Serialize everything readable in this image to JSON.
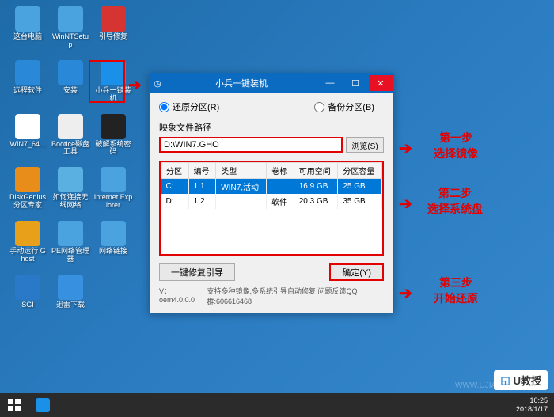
{
  "desktop_icons": [
    {
      "name": "mypc",
      "label": "这台电脑",
      "color": "#4aa3df"
    },
    {
      "name": "winntsetup",
      "label": "WinNTSetup",
      "color": "#4aa3df"
    },
    {
      "name": "bootrepair",
      "label": "引导修复",
      "color": "#d63333"
    },
    {
      "name": "remote",
      "label": "远程软件",
      "color": "#2a88d8"
    },
    {
      "name": "install",
      "label": "安装",
      "color": "#2a88d8"
    },
    {
      "name": "xiaobingk",
      "label": "小兵一键装机",
      "color": "#1a90e8"
    },
    {
      "name": "win764",
      "label": "WIN7_64...",
      "color": "#fff"
    },
    {
      "name": "bootice",
      "label": "Bootice磁盘工具",
      "color": "#eee"
    },
    {
      "name": "ntpwedit",
      "label": "破解系统密码",
      "color": "#222"
    },
    {
      "name": "diskgenius",
      "label": "DiskGenius 分区专家",
      "color": "#e88c1a"
    },
    {
      "name": "wifi",
      "label": "如何连接无线网络",
      "color": "#5ab0e0"
    },
    {
      "name": "ie",
      "label": "Internet Explorer",
      "color": "#4aa3df"
    },
    {
      "name": "ghost",
      "label": "手动运行 Ghost",
      "color": "#e8a01a"
    },
    {
      "name": "perouter",
      "label": "PE网络管理器",
      "color": "#4aa3df"
    },
    {
      "name": "netlink",
      "label": "网络链接",
      "color": "#4aa3df"
    },
    {
      "name": "sgi",
      "label": "SGI",
      "color": "#2a78c8"
    },
    {
      "name": "xunlei",
      "label": "迅雷下载",
      "color": "#3890e0"
    }
  ],
  "window": {
    "title": "小兵一键装机",
    "radio_restore": "还原分区(R)",
    "radio_backup": "备份分区(B)",
    "path_label": "映象文件路径",
    "path_value": "D:\\WIN7.GHO",
    "browse_label": "浏览(S)",
    "columns": [
      "分区",
      "编号",
      "类型",
      "卷标",
      "可用空间",
      "分区容量"
    ],
    "rows": [
      {
        "part": "C:",
        "num": "1:1",
        "type": "WIN7,活动",
        "vol": "",
        "free": "16.9 GB",
        "cap": "25 GB",
        "selected": true
      },
      {
        "part": "D:",
        "num": "1:2",
        "type": "",
        "vol": "软件",
        "free": "20.3 GB",
        "cap": "35 GB",
        "selected": false
      }
    ],
    "repair_label": "一键修复引导",
    "ok_label": "确定(Y)",
    "version": "V：oem4.0.0.0",
    "version_tip": "支持多种镜像,多系统引导自动修复 问题反馈QQ群:606616468"
  },
  "annotations": {
    "step1a": "第一步",
    "step1b": "选择镜像",
    "step2a": "第二步",
    "step2b": "选择系统盘",
    "step3a": "第三步",
    "step3b": "开始还原"
  },
  "taskbar": {
    "time": "10:25",
    "date": "2018/1/17"
  },
  "watermark": "WWW.UJIAOSHOU.COM",
  "logo": "U教授"
}
